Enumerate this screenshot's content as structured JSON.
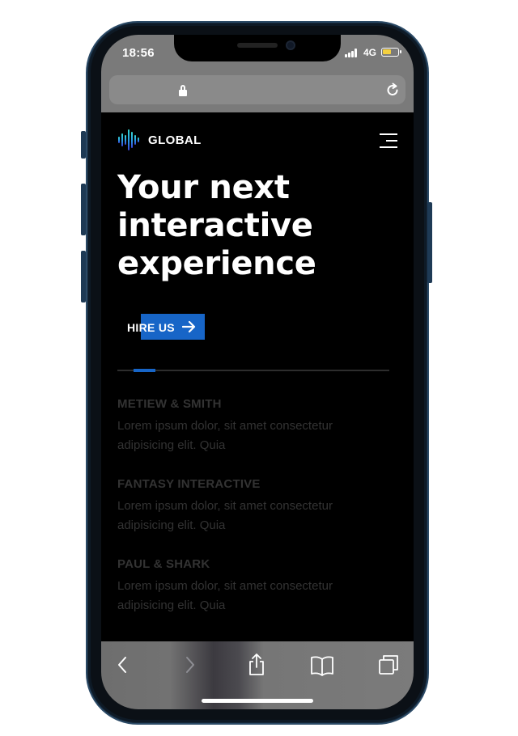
{
  "status_bar": {
    "time": "18:56",
    "network": "4G",
    "battery_level": 0.6,
    "battery_color": "#f4d03f"
  },
  "browser": {
    "lock_icon": "lock-icon",
    "reload_icon": "reload-icon"
  },
  "site": {
    "logo_text": "GLOBAL",
    "menu_icon": "hamburger-menu-icon",
    "hero_lines": [
      "Your next",
      "interactive",
      "experience"
    ],
    "cta_label": "HIRE US",
    "cta_icon": "arrow-right-icon",
    "accent_color": "#1765c7",
    "clients": [
      {
        "name": "METIEW & SMITH",
        "desc_line1": "Lorem ipsum dolor, sit amet consectetur",
        "desc_line2": "adipisicing elit. Quia"
      },
      {
        "name": "FANTASY INTERACTIVE",
        "desc_line1": "Lorem ipsum dolor, sit amet consectetur",
        "desc_line2": "adipisicing elit. Quia"
      },
      {
        "name": "PAUL & SHARK",
        "desc_line1": "Lorem ipsum dolor, sit amet consectetur",
        "desc_line2": "adipisicing elit. Quia"
      }
    ]
  },
  "toolbar": {
    "icons": [
      "back-icon",
      "forward-icon",
      "share-icon",
      "bookmarks-icon",
      "tabs-icon"
    ]
  }
}
